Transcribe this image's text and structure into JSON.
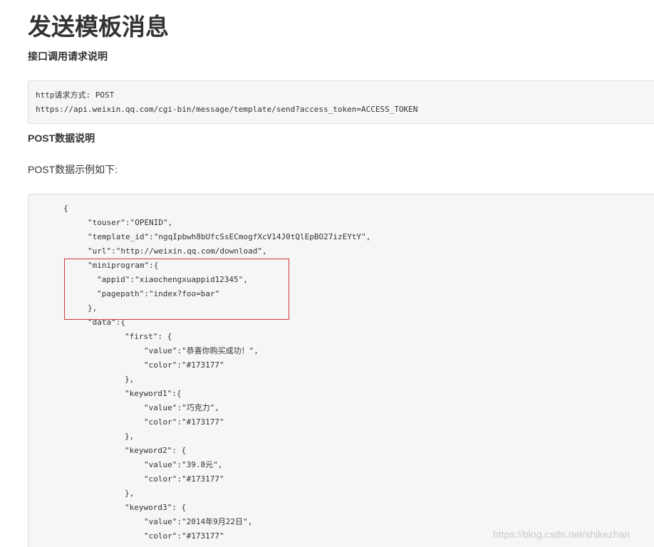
{
  "title": "发送模板消息",
  "section_api": {
    "heading": "接口调用请求说明",
    "code_lines": [
      "http请求方式: POST",
      "https://api.weixin.qq.com/cgi-bin/message/template/send?access_token=ACCESS_TOKEN"
    ]
  },
  "section_post": {
    "heading": "POST数据说明",
    "intro": "POST数据示例如下:",
    "code_lines": [
      "{",
      "\"touser\":\"OPENID\",",
      "\"template_id\":\"ngqIpbwh8bUfcSsECmogfXcV14J0tQlEpBO27izEYtY\",",
      "\"url\":\"http://weixin.qq.com/download\",",
      "\"miniprogram\":{",
      "\"appid\":\"xiaochengxuappid12345\",",
      "\"pagepath\":\"index?foo=bar\"",
      "},",
      "\"data\":{",
      "\"first\": {",
      "\"value\":\"恭喜你购买成功！\",",
      "\"color\":\"#173177\"",
      "},",
      "\"keyword1\":{",
      "\"value\":\"巧克力\",",
      "\"color\":\"#173177\"",
      "},",
      "\"keyword2\": {",
      "\"value\":\"39.8元\",",
      "\"color\":\"#173177\"",
      "},",
      "\"keyword3\": {",
      "\"value\":\"2014年9月22日\",",
      "\"color\":\"#173177\""
    ]
  },
  "watermark": "https://blog.csdn.net/shikezhan",
  "colors": {
    "highlight_border": "#d9363e",
    "code_background": "#f6f6f6"
  }
}
